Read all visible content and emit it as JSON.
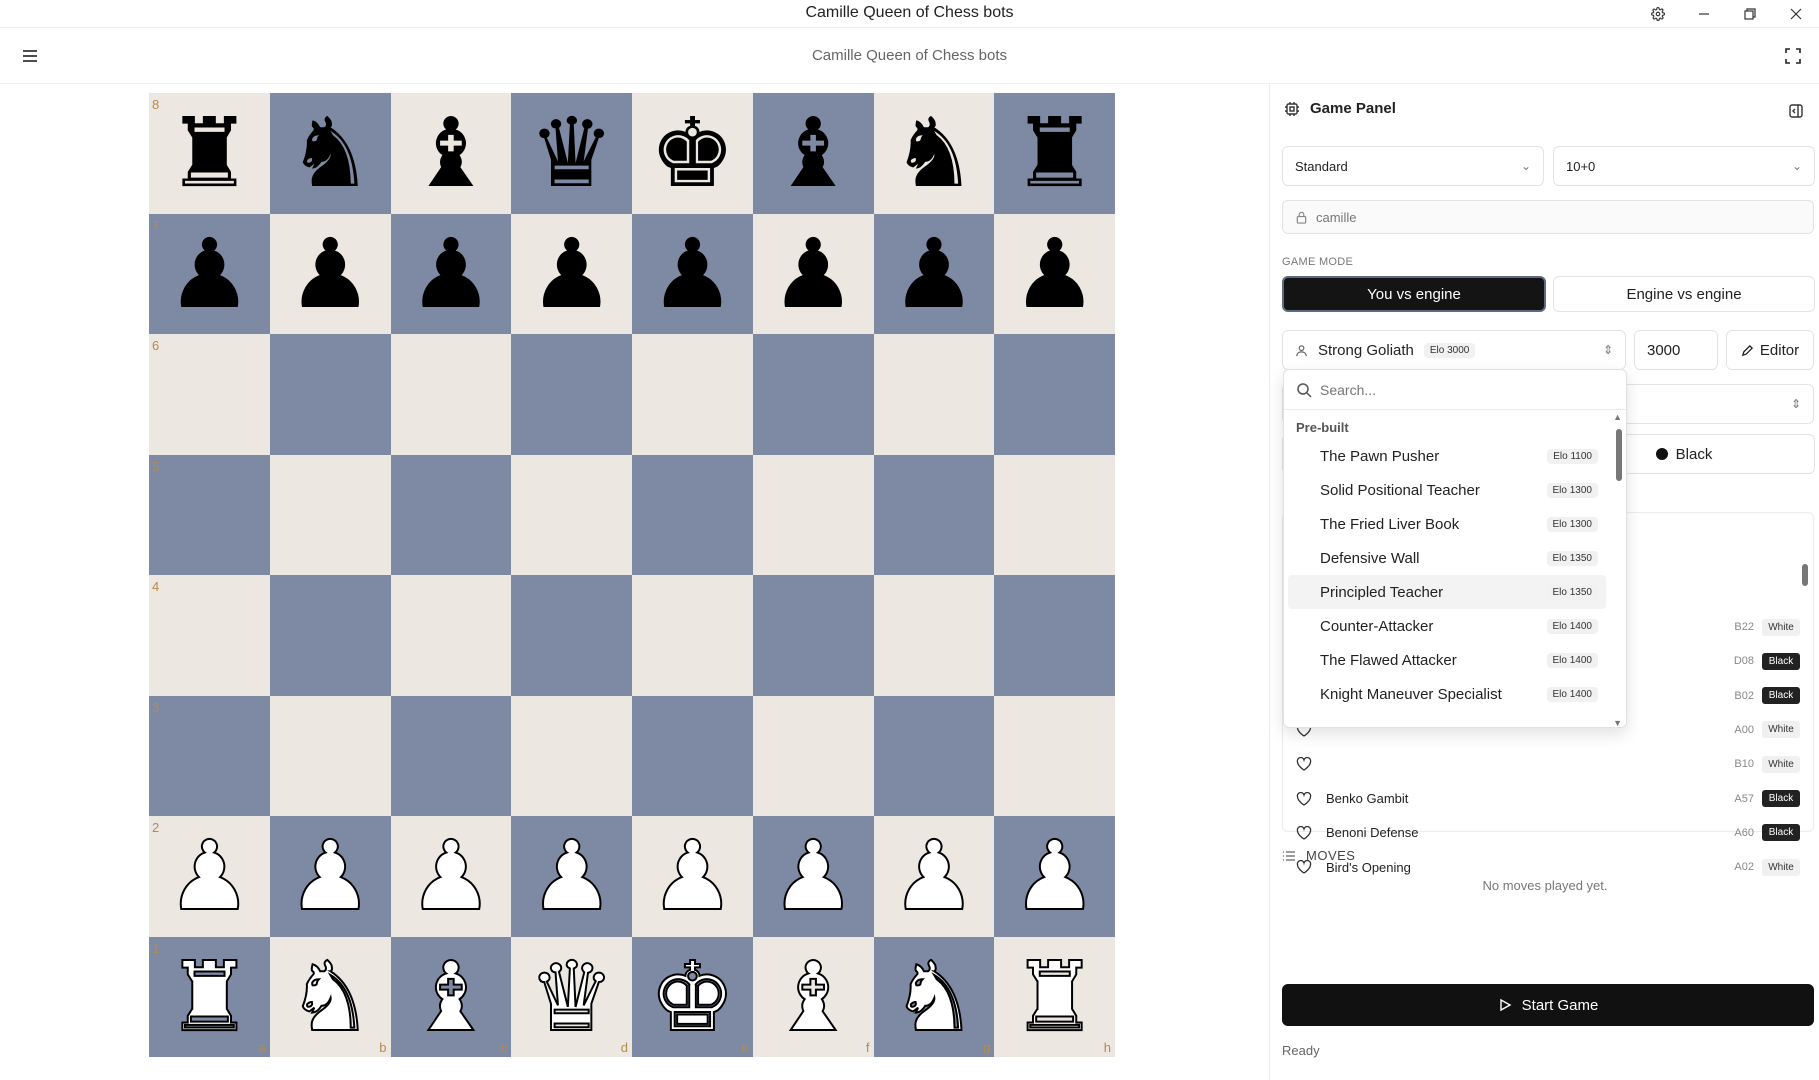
{
  "window": {
    "title": "Camille Queen of Chess bots"
  },
  "header": {
    "subtitle": "Camille Queen of Chess bots"
  },
  "board": {
    "ranks": [
      "8",
      "7",
      "6",
      "5",
      "4",
      "3",
      "2",
      "1"
    ],
    "files": [
      "a",
      "b",
      "c",
      "d",
      "e",
      "f",
      "g",
      "h"
    ],
    "rows": [
      [
        "♜",
        "♞",
        "♝",
        "♛",
        "♚",
        "♝",
        "♞",
        "♜"
      ],
      [
        "♟",
        "♟",
        "♟",
        "♟",
        "♟",
        "♟",
        "♟",
        "♟"
      ],
      [
        "",
        "",
        "",
        "",
        "",
        "",
        "",
        ""
      ],
      [
        "",
        "",
        "",
        "",
        "",
        "",
        "",
        ""
      ],
      [
        "",
        "",
        "",
        "",
        "",
        "",
        "",
        ""
      ],
      [
        "",
        "",
        "",
        "",
        "",
        "",
        "",
        ""
      ],
      [
        "♙",
        "♙",
        "♙",
        "♙",
        "♙",
        "♙",
        "♙",
        "♙"
      ],
      [
        "♖",
        "♘",
        "♗",
        "♕",
        "♔",
        "♗",
        "♘",
        "♖"
      ]
    ],
    "colors": {
      "light": "#ece8e1",
      "dark": "#7e8aa3",
      "coord": "#b88a4a"
    }
  },
  "panel": {
    "title": "Game Panel",
    "variant": "Standard",
    "time_control": "10+0",
    "player_name": "camille",
    "game_mode_label": "GAME MODE",
    "mode_you": "You vs engine",
    "mode_engine": "Engine vs engine",
    "bot_name": "Strong Goliath",
    "bot_elo": "Elo 3000",
    "elo_value": "3000",
    "editor_label": "Editor",
    "color_black": "Black",
    "openings": [
      {
        "name": "",
        "eco": "B22",
        "side": "White"
      },
      {
        "name": "",
        "eco": "D08",
        "side": "Black"
      },
      {
        "name": "",
        "eco": "B02",
        "side": "Black"
      },
      {
        "name": "",
        "eco": "A00",
        "side": "White"
      },
      {
        "name": "",
        "eco": "B10",
        "side": "White"
      },
      {
        "name": "Benko Gambit",
        "eco": "A57",
        "side": "Black"
      },
      {
        "name": "Benoni Defense",
        "eco": "A60",
        "side": "Black"
      },
      {
        "name": "Bird's Opening",
        "eco": "A02",
        "side": "White"
      }
    ],
    "moves_label": "MOVES",
    "moves_empty": "No moves played yet.",
    "start_label": "Start Game",
    "status": "Ready"
  },
  "dropdown": {
    "search_placeholder": "Search...",
    "group": "Pre-built",
    "items": [
      {
        "name": "The Pawn Pusher",
        "elo": "Elo 1100"
      },
      {
        "name": "Solid Positional Teacher",
        "elo": "Elo 1300"
      },
      {
        "name": "The Fried Liver Book",
        "elo": "Elo 1300"
      },
      {
        "name": "Defensive Wall",
        "elo": "Elo 1350"
      },
      {
        "name": "Principled Teacher",
        "elo": "Elo 1350"
      },
      {
        "name": "Counter-Attacker",
        "elo": "Elo 1400"
      },
      {
        "name": "The Flawed Attacker",
        "elo": "Elo 1400"
      },
      {
        "name": "Knight Maneuver Specialist",
        "elo": "Elo 1400"
      }
    ],
    "highlighted_index": 4
  }
}
